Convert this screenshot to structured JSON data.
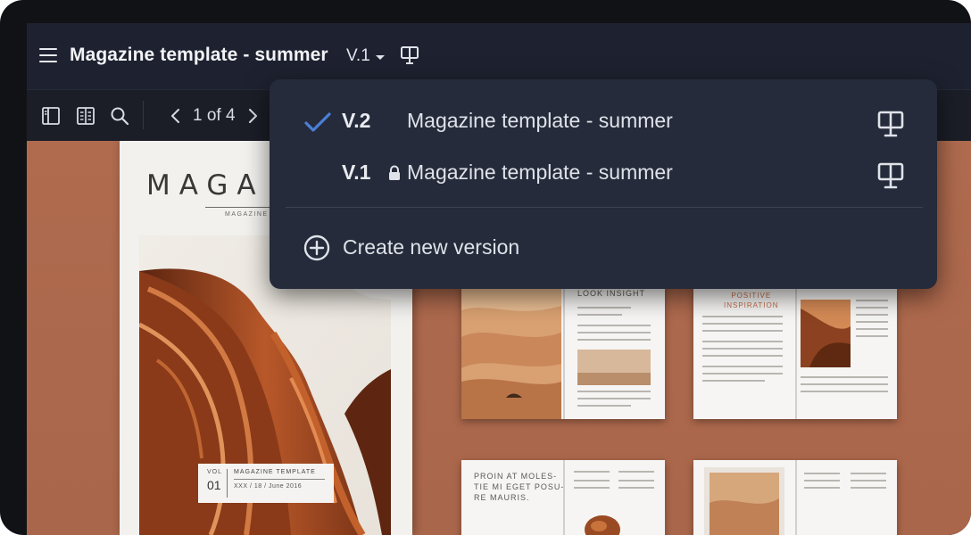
{
  "header": {
    "document_title": "Magazine template - summer",
    "current_version": "V.1"
  },
  "toolbar": {
    "page_indicator": "1 of 4"
  },
  "version_menu": {
    "items": [
      {
        "version": "V.2",
        "name": "Magazine template - summer",
        "selected": true,
        "locked": false
      },
      {
        "version": "V.1",
        "name": "Magazine template - summer",
        "selected": false,
        "locked": true
      }
    ],
    "create_label": "Create new version"
  },
  "canvas": {
    "cover": {
      "title": "MAGA",
      "subtitle": "MAGAZINE TE",
      "label_vol": "VOL",
      "label_num": "01",
      "label_title": "MAGAZINE TEMPLATE",
      "label_date": "XXX / 18 / June 2016"
    },
    "spreads": {
      "a_heading": "LOOK INSIGHT",
      "b_heading": "POSITIVE\nINSPIRATION",
      "c_heading": "PROIN AT MOLES-\nTIE MI EGET POSU-\nRE MAURIS."
    }
  },
  "colors": {
    "accent_check": "#4a7fd6",
    "menu_bg": "#252b3a",
    "canvas_bg": "#b06b4f"
  },
  "icons": [
    "menu-icon",
    "present-icon",
    "sidebar-panel-icon",
    "page-grid-icon",
    "search-icon",
    "chevron-left-icon",
    "chevron-right-icon",
    "checkmark-icon",
    "lock-icon",
    "plus-circle-icon"
  ]
}
